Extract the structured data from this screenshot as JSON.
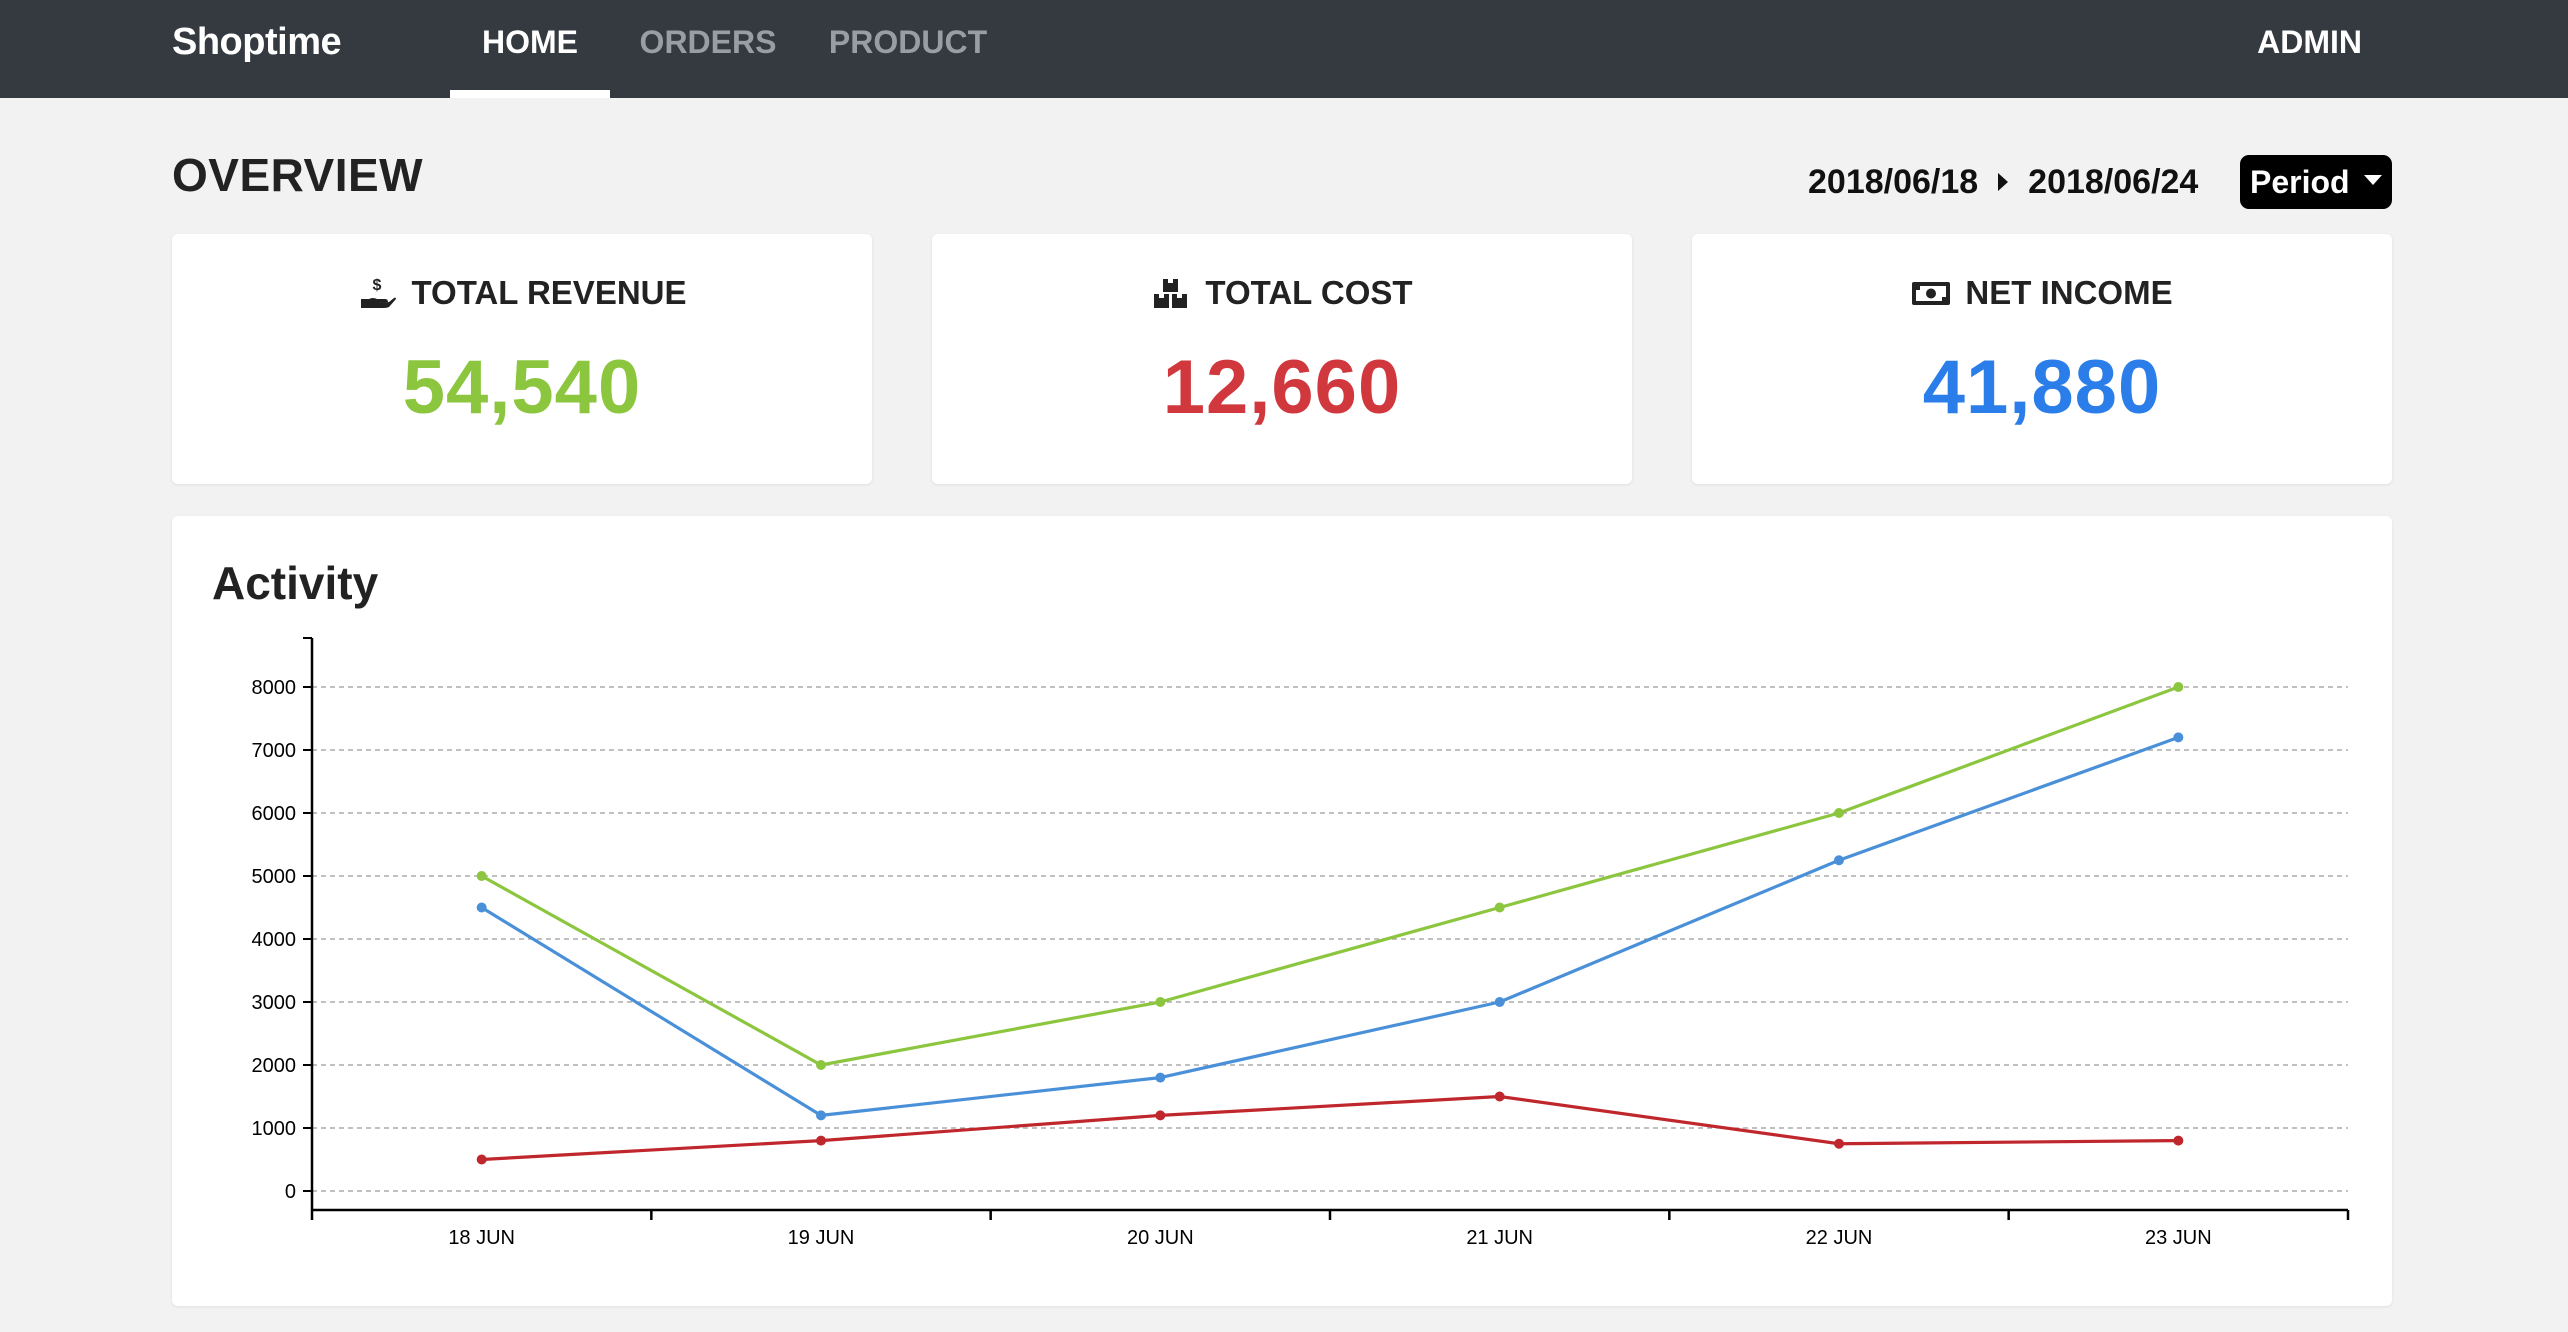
{
  "navbar": {
    "brand": "Shoptime",
    "tabs": [
      {
        "label": "HOME",
        "active": true
      },
      {
        "label": "ORDERS",
        "active": false
      },
      {
        "label": "PRODUCT",
        "active": false
      }
    ],
    "user": "ADMIN"
  },
  "header": {
    "title": "OVERVIEW",
    "date_from": "2018/06/18",
    "date_to": "2018/06/24",
    "period_label": "Period"
  },
  "cards": [
    {
      "label": "TOTAL REVENUE",
      "value": "54,540",
      "icon": "hand-holding-dollar-icon",
      "color": "#8cc63f"
    },
    {
      "label": "TOTAL COST",
      "value": "12,660",
      "icon": "boxes-icon",
      "color": "#d0383e"
    },
    {
      "label": "NET INCOME",
      "value": "41,880",
      "icon": "money-bill-icon",
      "color": "#2b7de9"
    }
  ],
  "activity": {
    "title": "Activity"
  },
  "chart_data": {
    "type": "line",
    "categories": [
      "18 JUN",
      "19 JUN",
      "20 JUN",
      "21 JUN",
      "22 JUN",
      "23 JUN"
    ],
    "series": [
      {
        "color": "#8cc63f",
        "values": [
          5000,
          2000,
          3000,
          4500,
          6000,
          8000
        ]
      },
      {
        "color": "#4a90d9",
        "values": [
          4500,
          1200,
          1800,
          3000,
          5250,
          7200
        ]
      },
      {
        "color": "#c0272d",
        "values": [
          500,
          800,
          1200,
          1500,
          750,
          800
        ]
      }
    ],
    "yticks": [
      0,
      1000,
      2000,
      3000,
      4000,
      5000,
      6000,
      7000,
      8000
    ],
    "ylim": [
      0,
      8000
    ],
    "grid": true,
    "legend": "none"
  }
}
